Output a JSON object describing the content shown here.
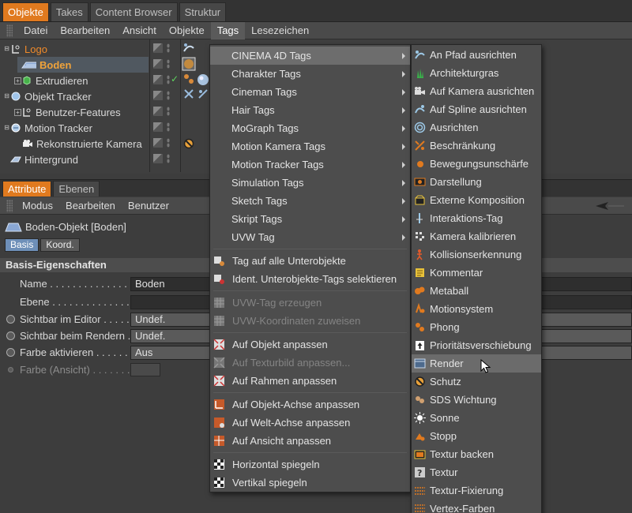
{
  "top_tabs": [
    "Objekte",
    "Takes",
    "Content Browser",
    "Struktur"
  ],
  "menubar": [
    "Datei",
    "Bearbeiten",
    "Ansicht",
    "Objekte",
    "Tags",
    "Lesezeichen"
  ],
  "objects": [
    {
      "name": "Logo",
      "icon": "null-object-icon"
    },
    {
      "name": "Boden",
      "icon": "floor-icon"
    },
    {
      "name": "Extrudieren",
      "icon": "extrude-icon"
    },
    {
      "name": "Objekt Tracker",
      "icon": "object-tracker-icon"
    },
    {
      "name": "Benutzer-Features",
      "icon": "null-object-icon"
    },
    {
      "name": "Motion Tracker",
      "icon": "motion-tracker-icon"
    },
    {
      "name": "Rekonstruierte Kamera",
      "icon": "camera-icon"
    },
    {
      "name": "Hintergrund",
      "icon": "background-icon"
    }
  ],
  "attr_tabs": [
    "Attribute",
    "Ebenen"
  ],
  "attr_menu": [
    "Modus",
    "Bearbeiten",
    "Benutzer"
  ],
  "object_title": "Boden-Objekt [Boden]",
  "sub_tabs": [
    "Basis",
    "Koord."
  ],
  "section": "Basis-Eigenschaften",
  "properties": [
    {
      "label": "Name . . . . . . . . . . . . . . . . .",
      "value": "Boden"
    },
    {
      "label": "Ebene . . . . . . . . . . . . . . . .",
      "value": ""
    },
    {
      "label": "Sichtbar im Editor . . . . . . . . .",
      "value": "Undef."
    },
    {
      "label": "Sichtbar beim Rendern . . . . . .",
      "value": "Undef."
    },
    {
      "label": "Farbe aktivieren . . . . . . . . . .",
      "value": "Aus"
    },
    {
      "label": "Farbe (Ansicht) . . . . . . . .",
      "value": ""
    }
  ],
  "tags_menu": {
    "submenus": [
      "CINEMA 4D Tags",
      "Charakter Tags",
      "Cineman Tags",
      "Hair Tags",
      "MoGraph Tags",
      "Motion Kamera Tags",
      "Motion Tracker Tags",
      "Simulation Tags",
      "Sketch Tags",
      "Skript Tags",
      "UVW Tag"
    ],
    "group_children": [
      "Tag auf alle Unterobjekte",
      "Ident. Unterobjekte-Tags selektieren"
    ],
    "group_uvw": [
      "UVW-Tag erzeugen",
      "UVW-Koordinaten zuweisen"
    ],
    "group_fit": [
      "Auf Objekt anpassen",
      "Auf Texturbild anpassen...",
      "Auf Rahmen anpassen"
    ],
    "group_axis": [
      "Auf Objekt-Achse anpassen",
      "Auf Welt-Achse anpassen",
      "Auf Ansicht anpassen"
    ],
    "group_mirror": [
      "Horizontal spiegeln",
      "Vertikal spiegeln"
    ]
  },
  "c4d_tags": [
    "An Pfad ausrichten",
    "Architekturgras",
    "Auf Kamera ausrichten",
    "Auf Spline ausrichten",
    "Ausrichten",
    "Beschränkung",
    "Bewegungsunschärfe",
    "Darstellung",
    "Externe Komposition",
    "Interaktions-Tag",
    "Kamera kalibrieren",
    "Kollisionserkennung",
    "Kommentar",
    "Metaball",
    "Motionsystem",
    "Phong",
    "Prioritätsverschiebung",
    "Render",
    "Schutz",
    "SDS Wichtung",
    "Sonne",
    "Stopp",
    "Textur backen",
    "Textur",
    "Textur-Fixierung",
    "Vertex-Farben"
  ],
  "colors": {
    "accent": "#e07a1f",
    "selected_name": "#f0a33a",
    "highlight": "#6d6d6d"
  }
}
